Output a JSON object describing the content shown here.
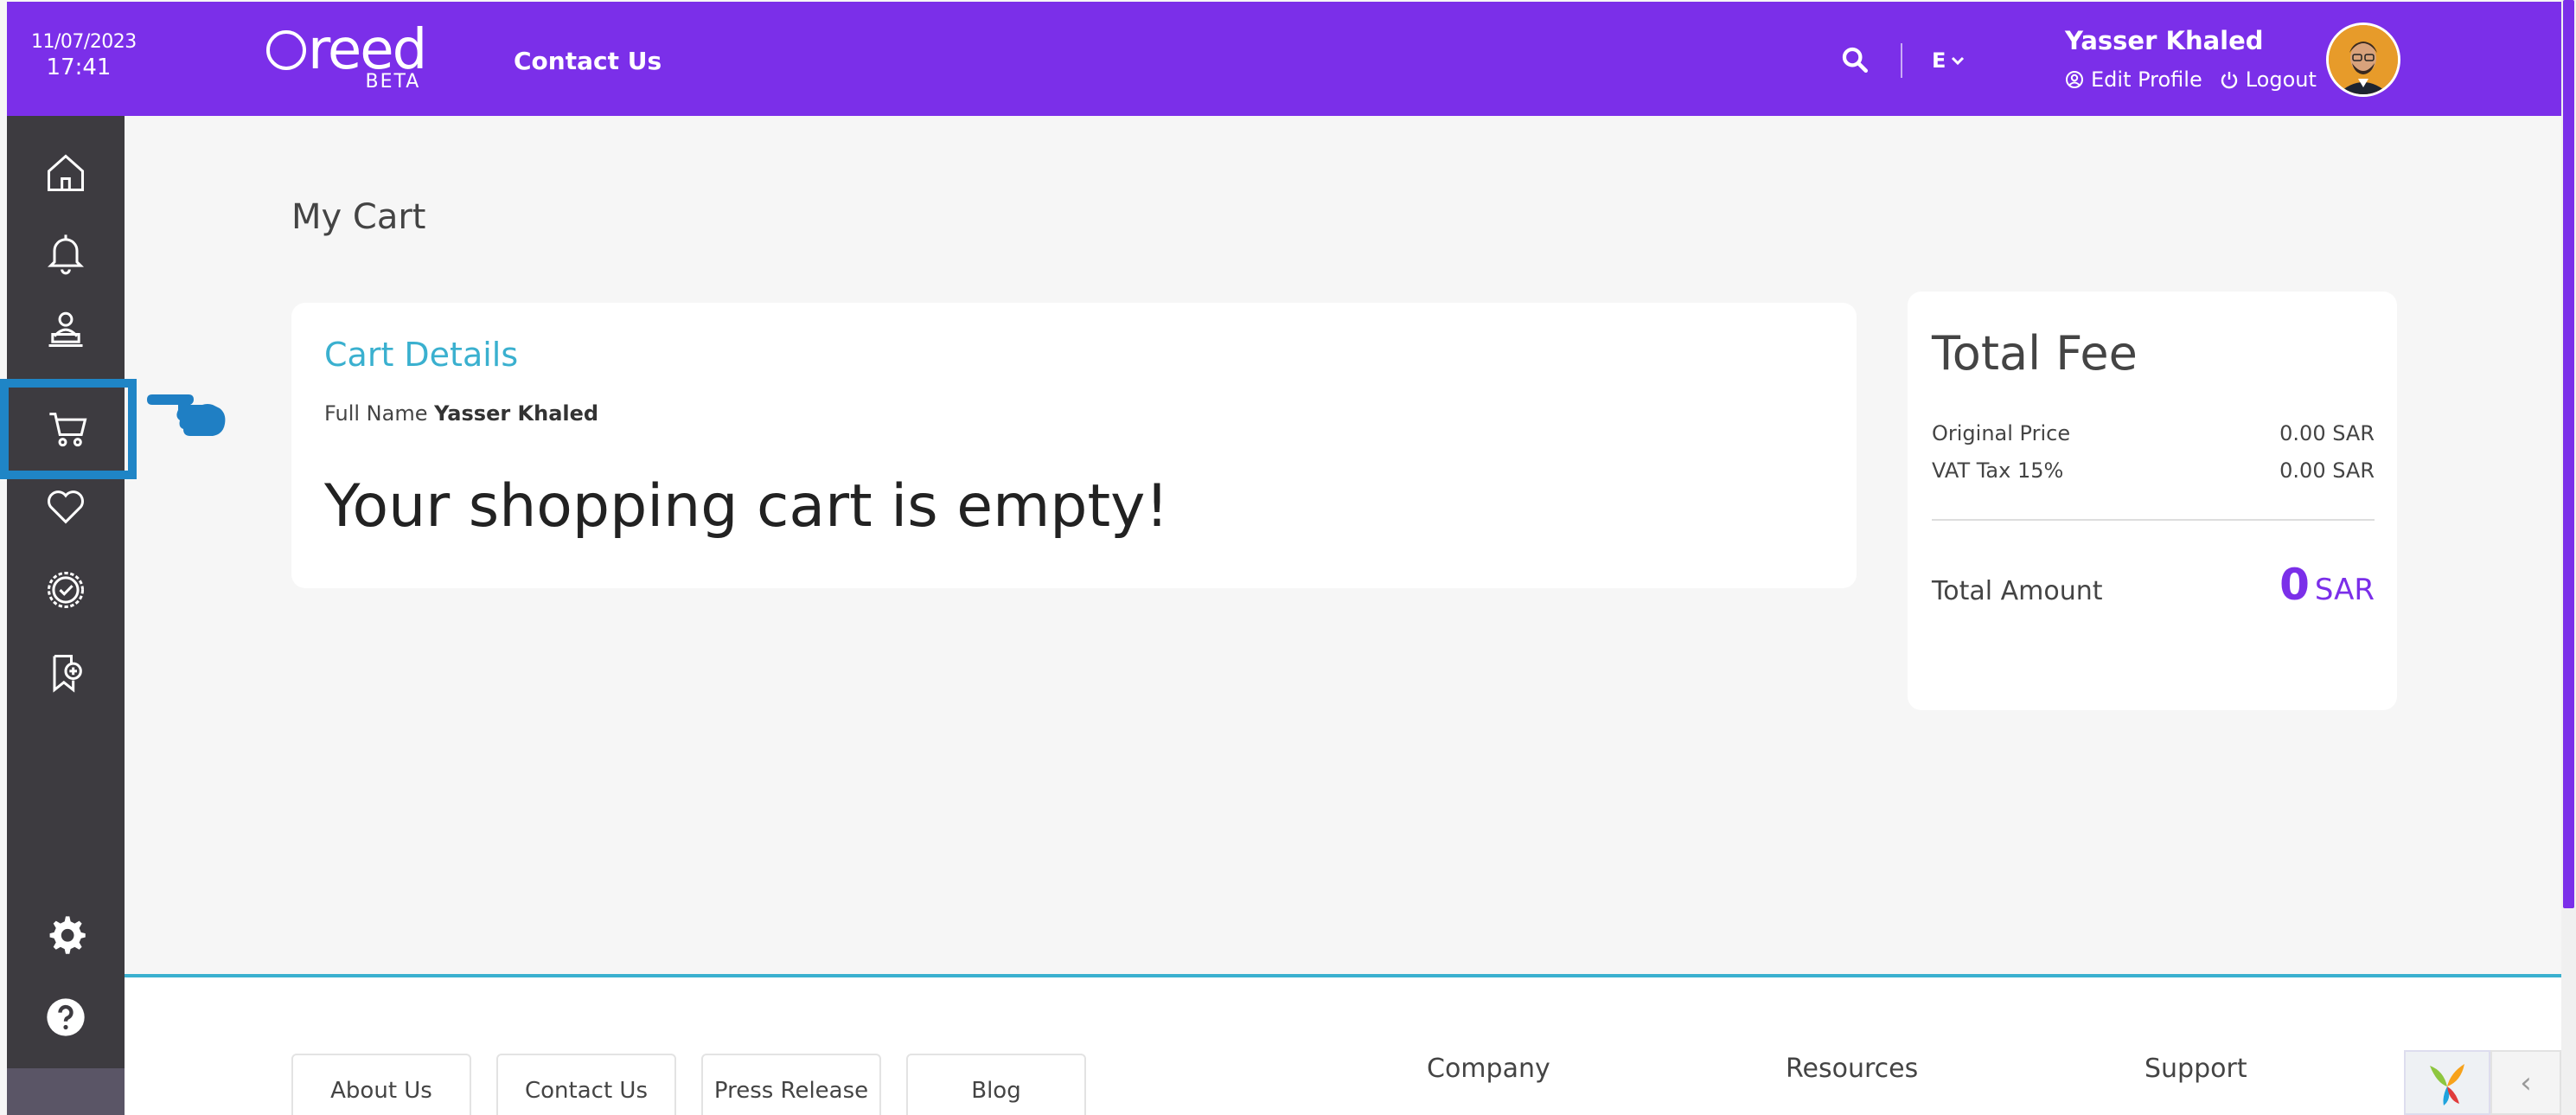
{
  "header": {
    "date": "11/07/2023",
    "time": "17:41",
    "logo_text": "reed",
    "logo_badge": "BETA",
    "contact_label": "Contact Us",
    "lang_label": "E",
    "user_name": "Yasser Khaled",
    "edit_profile": "Edit Profile",
    "logout": "Logout"
  },
  "sidebar": {
    "items": [
      {
        "icon": "home-icon"
      },
      {
        "icon": "bell-icon"
      },
      {
        "icon": "instructor-icon"
      },
      {
        "icon": "cart-icon",
        "active": true
      },
      {
        "icon": "heart-icon"
      },
      {
        "icon": "certificate-icon"
      },
      {
        "icon": "bookmark-add-icon"
      }
    ],
    "bottom": [
      {
        "icon": "gear-icon"
      },
      {
        "icon": "help-icon"
      }
    ]
  },
  "main": {
    "page_title": "My Cart",
    "cart": {
      "heading": "Cart Details",
      "full_name_label": "Full Name",
      "full_name_value": "Yasser Khaled",
      "empty_message": "Your shopping cart is empty!"
    },
    "fee": {
      "title": "Total Fee",
      "original_price_label": "Original Price",
      "original_price_value": "0.00 SAR",
      "vat_label": "VAT Tax 15%",
      "vat_value": "0.00 SAR",
      "total_label": "Total Amount",
      "total_value": "0",
      "total_currency": "SAR"
    }
  },
  "footer": {
    "buttons": [
      "About Us",
      "Contact Us",
      "Press Release",
      "Blog"
    ],
    "columns": [
      "Company",
      "Resources",
      "Support"
    ]
  },
  "colors": {
    "brand_purple": "#7b2fe9",
    "accent_cyan": "#3ab0cf",
    "sidebar_dark": "#3d3b40",
    "active_blue": "#1f85c6"
  }
}
